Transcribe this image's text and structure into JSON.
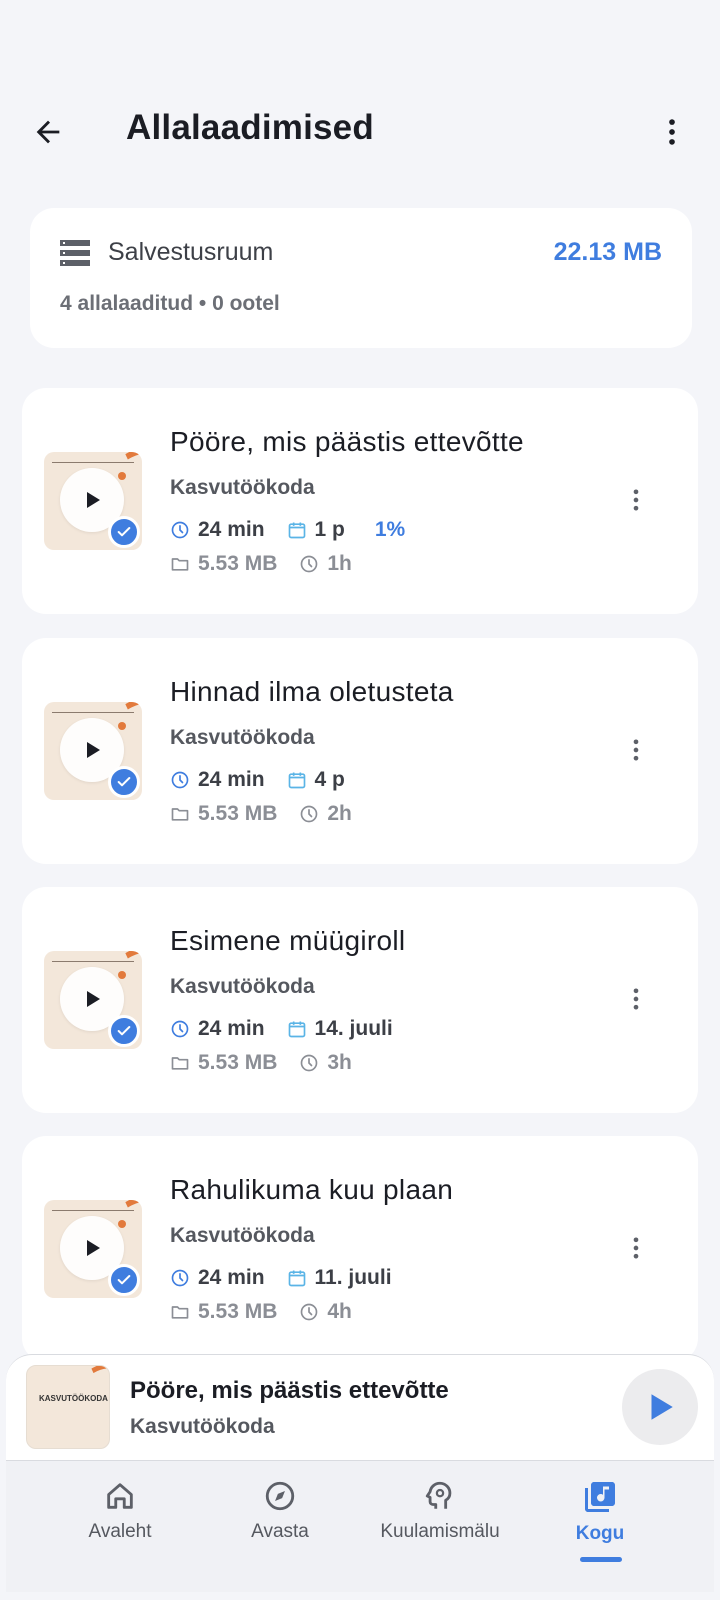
{
  "header": {
    "title": "Allalaadimised"
  },
  "storage": {
    "label": "Salvestusruum",
    "size": "22.13 MB",
    "summary": "4 allalaaditud • 0 ootel"
  },
  "episodes": [
    {
      "title": "Pööre, mis päästis ettevõtte",
      "show": "Kasvutöökoda",
      "duration": "24 min",
      "date": "1 p",
      "progress": "1%",
      "size": "5.53 MB",
      "downloaded_ago": "1h"
    },
    {
      "title": "Hinnad ilma oletusteta",
      "show": "Kasvutöökoda",
      "duration": "24 min",
      "date": "4 p",
      "progress": "",
      "size": "5.53 MB",
      "downloaded_ago": "2h"
    },
    {
      "title": "Esimene müügiroll",
      "show": "Kasvutöökoda",
      "duration": "24 min",
      "date": "14. juuli",
      "progress": "",
      "size": "5.53 MB",
      "downloaded_ago": "3h"
    },
    {
      "title": "Rahulikuma kuu plaan",
      "show": "Kasvutöökoda",
      "duration": "24 min",
      "date": "11. juuli",
      "progress": "",
      "size": "5.53 MB",
      "downloaded_ago": "4h"
    }
  ],
  "mini_player": {
    "title": "Pööre, mis päästis ettevõtte",
    "show": "Kasvutöökoda",
    "art_text": "KASVUTÖÖKODA"
  },
  "nav": {
    "items": [
      {
        "label": "Avaleht",
        "icon": "home-icon"
      },
      {
        "label": "Avasta",
        "icon": "compass-icon"
      },
      {
        "label": "Kuulamismälu",
        "icon": "brain-icon"
      },
      {
        "label": "Kogu",
        "icon": "library-music-icon"
      }
    ],
    "active": "Kogu"
  },
  "colors": {
    "accent": "#3f7ddf",
    "background": "#f4f5f9",
    "card": "#ffffff",
    "thumb_orange": "#e27a3c"
  }
}
